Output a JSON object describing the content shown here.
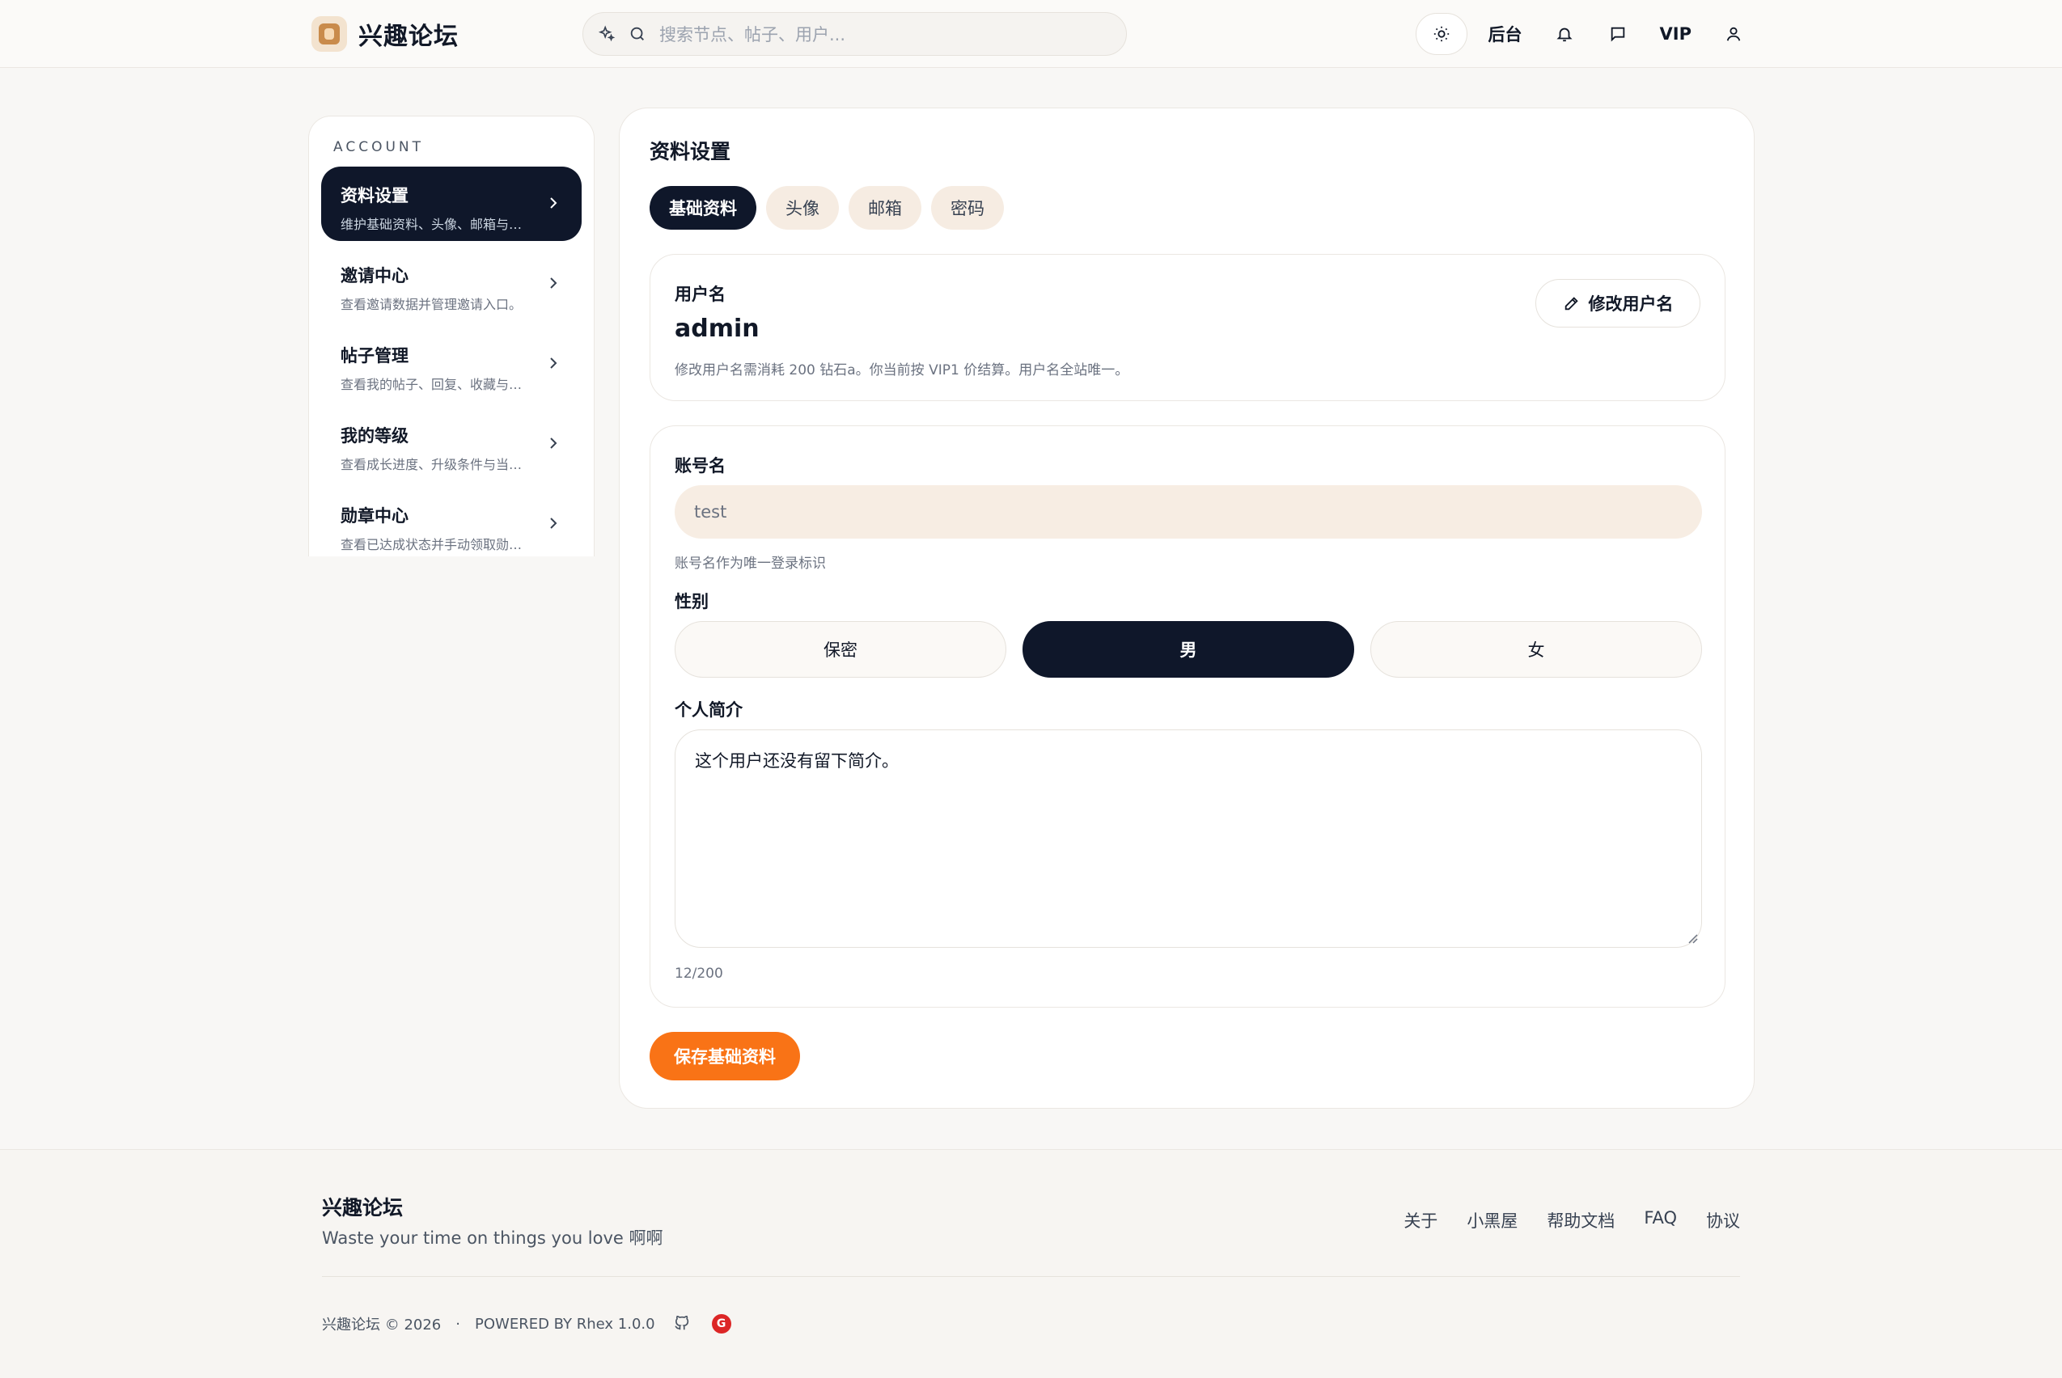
{
  "header": {
    "brand": "兴趣论坛",
    "search_placeholder": "搜索节点、帖子、用户...",
    "admin_label": "后台",
    "vip_label": "VIP"
  },
  "sidebar": {
    "section_title": "ACCOUNT",
    "items": [
      {
        "title": "资料设置",
        "desc": "维护基础资料、头像、邮箱与密码。"
      },
      {
        "title": "邀请中心",
        "desc": "查看邀请数据并管理邀请入口。"
      },
      {
        "title": "帖子管理",
        "desc": "查看我的帖子、回复、收藏与点赞。"
      },
      {
        "title": "我的等级",
        "desc": "查看成长进度、升级条件与当前等级。"
      },
      {
        "title": "勋章中心",
        "desc": "查看已达成状态并手动领取勋章。"
      }
    ]
  },
  "main": {
    "title": "资料设置",
    "tabs": [
      "基础资料",
      "头像",
      "邮箱",
      "密码"
    ],
    "username": {
      "label": "用户名",
      "value": "admin",
      "hint": "修改用户名需消耗 200 钻石a。你当前按 VIP1 价结算。用户名全站唯一。",
      "edit_label": "修改用户名"
    },
    "account": {
      "label": "账号名",
      "value": "test",
      "hint": "账号名作为唯一登录标识"
    },
    "gender": {
      "label": "性别",
      "options": [
        "保密",
        "男",
        "女"
      ],
      "selected": "男"
    },
    "bio": {
      "label": "个人简介",
      "value": "这个用户还没有留下简介。",
      "count": "12/200"
    },
    "save_label": "保存基础资料"
  },
  "footer": {
    "name": "兴趣论坛",
    "slogan": "Waste your time on things you love 啊啊",
    "links": [
      "关于",
      "小黑屋",
      "帮助文档",
      "FAQ",
      "协议"
    ],
    "copyright": "兴趣论坛 © 2026",
    "dot": "·",
    "powered": "POWERED BY Rhex 1.0.0",
    "badge_letter": "G"
  },
  "colors": {
    "accent": "#f97316",
    "dark": "#0f172a",
    "input_bg": "#f7ede3"
  }
}
